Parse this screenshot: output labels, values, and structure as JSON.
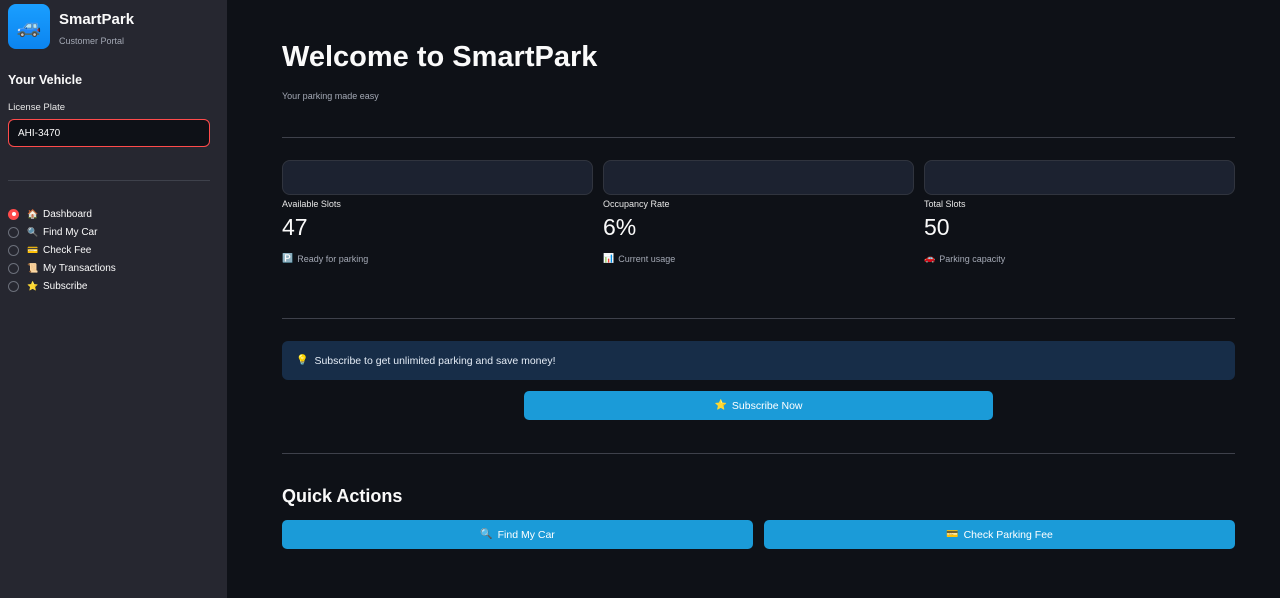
{
  "sidebar": {
    "logo_icon": "🚙",
    "app_name": "SmartPark",
    "portal_label": "Customer Portal",
    "section_title": "Your Vehicle",
    "plate_label": "License Plate",
    "plate_value": "AHI-3470",
    "nav": [
      {
        "icon": "🏠",
        "label": "Dashboard",
        "selected": true
      },
      {
        "icon": "🔍",
        "label": "Find My Car",
        "selected": false
      },
      {
        "icon": "💳",
        "label": "Check Fee",
        "selected": false
      },
      {
        "icon": "📜",
        "label": "My Transactions",
        "selected": false
      },
      {
        "icon": "⭐",
        "label": "Subscribe",
        "selected": false
      }
    ]
  },
  "main": {
    "title": "Welcome to SmartPark",
    "subtitle": "Your parking made easy",
    "metrics": [
      {
        "label": "Available Slots",
        "value": "47",
        "note_icon": "🅿️",
        "note": "Ready for parking"
      },
      {
        "label": "Occupancy Rate",
        "value": "6%",
        "note_icon": "📊",
        "note": "Current usage"
      },
      {
        "label": "Total Slots",
        "value": "50",
        "note_icon": "🚗",
        "note": "Parking capacity"
      }
    ],
    "info_icon": "💡",
    "info_text": "Subscribe to get unlimited parking and save money!",
    "subscribe_icon": "⭐",
    "subscribe_label": "Subscribe Now",
    "quick_actions_title": "Quick Actions",
    "find_icon": "🔍",
    "find_label": "Find My Car",
    "fee_icon": "💳",
    "fee_label": "Check Parking Fee"
  },
  "colors": {
    "accent": "#ff4b4b",
    "button": "#1b9bd8",
    "background": "#0e1117",
    "sidebar": "#262730",
    "info_bg": "#172d48"
  }
}
